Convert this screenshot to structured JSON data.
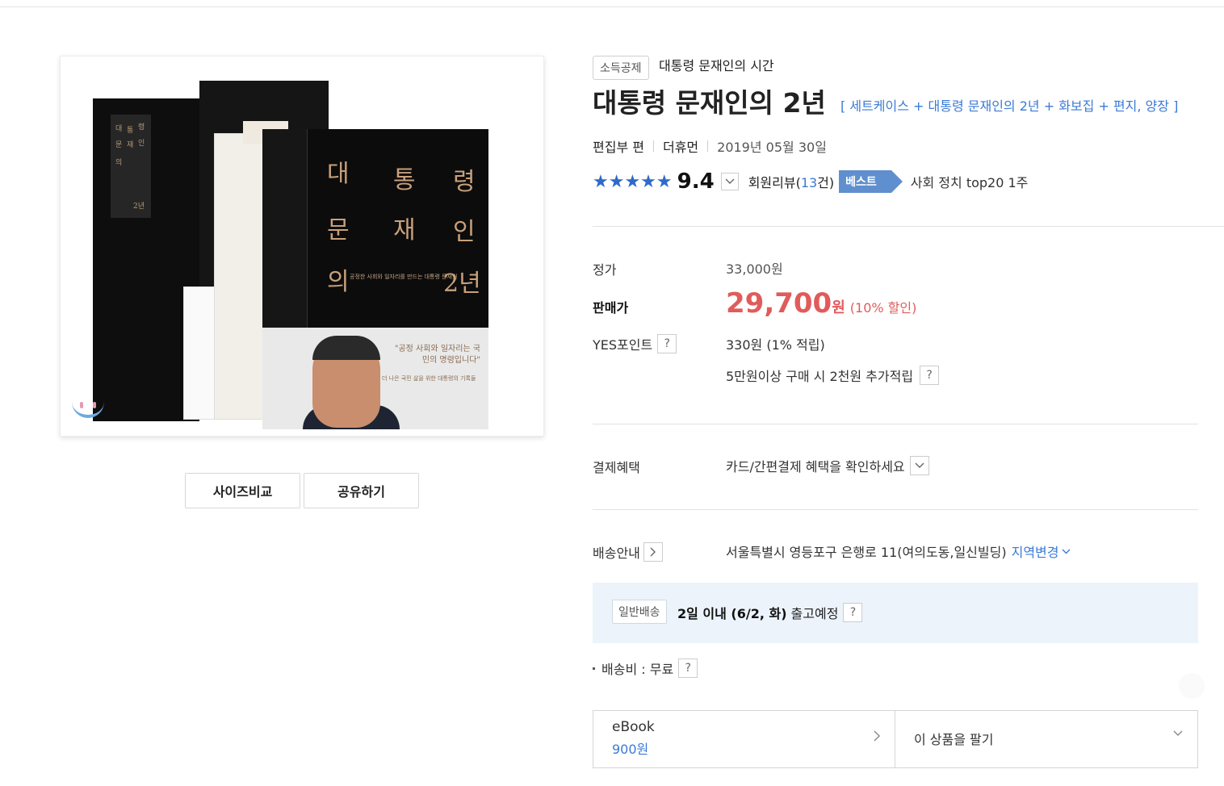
{
  "product": {
    "category_badge": "소득공제",
    "series_title": "대통령 문재인의 시간",
    "title": "대통령 문재인의 2년",
    "subtitle": "[ 세트케이스 + 대통령 문재인의 2년 + 화보집 + 편지, 양장 ]",
    "author": "편집부 편",
    "publisher": "더휴먼",
    "date": "2019년 05월 30일"
  },
  "rating": {
    "stars": "★★★★★",
    "score": "9.4",
    "review_prefix": "회원리뷰(",
    "review_count": "13",
    "review_suffix": "건)",
    "best_label": "베스트",
    "rank_text": "사회 정치 top20 1주"
  },
  "cover": {
    "title_chars": [
      "대",
      "통",
      "령",
      "문",
      "재",
      "인",
      "의",
      "2년"
    ],
    "spine_chars": [
      "대",
      "통",
      "령",
      "문",
      "재",
      "인",
      "의",
      "2년"
    ],
    "subtitle": "공정한 사회와 일자리를 만드는 대통령 문재인",
    "band_quote": "\"공정 사회와 일자리는 국민의 명령입니다\"",
    "band_sub": "더 나은 국민 삶을 위한 대통령의 기록들"
  },
  "image_buttons": {
    "size_compare": "사이즈비교",
    "share": "공유하기"
  },
  "price": {
    "list_label": "정가",
    "list_value": "33,000원",
    "sale_label": "판매가",
    "sale_number": "29,700",
    "sale_unit": "원",
    "discount": "(10% 할인)",
    "point_label": "YES포인트",
    "point_value": "330원 (1% 적립)",
    "extra_point": "5만원이상 구매 시 2천원 추가적립",
    "help": "?"
  },
  "payment": {
    "label": "결제혜택",
    "value": "카드/간편결제 혜택을 확인하세요"
  },
  "delivery": {
    "label": "배송안내",
    "address": "서울특별시 영등포구 은행로 11(여의도동,일신빌딩)",
    "region_change": "지역변경",
    "ship_type": "일반배송",
    "ship_eta": "2일 이내 (6/2, 화)",
    "ship_suffix": "출고예정",
    "fee_text": "배송비 : 무료"
  },
  "bottom": {
    "ebook_label": "eBook",
    "ebook_price": "900원",
    "sell_label": "이 상품을 팔기"
  },
  "colors": {
    "accent_blue": "#3a7ad6",
    "sale_red": "#e15b5b",
    "best_tag": "#5f8fce",
    "delivery_bg": "#ecf3fb"
  },
  "icons": [
    "chevron-down-icon",
    "chevron-right-icon",
    "help-icon",
    "star-icon",
    "yes24-logo-icon"
  ]
}
